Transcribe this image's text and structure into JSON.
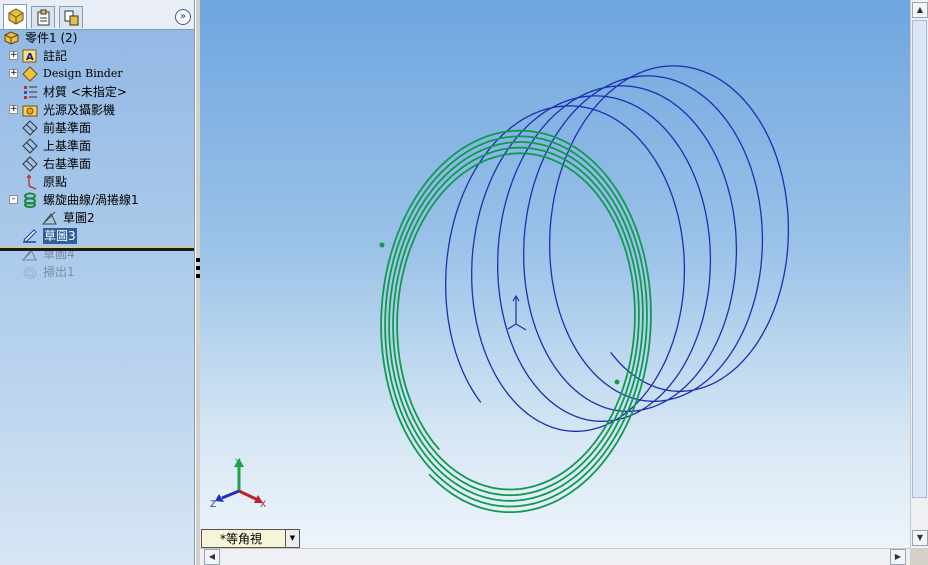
{
  "feature_manager": {
    "tabs": [
      {
        "icon": "feature-tree-icon",
        "active": true
      },
      {
        "icon": "property-manager-icon",
        "active": false
      },
      {
        "icon": "configuration-manager-icon",
        "active": false
      }
    ],
    "collapse_icon": "double-chevron-right-icon",
    "tree": [
      {
        "label": "零件1  (2)",
        "icon": "part-icon",
        "expander": "",
        "state": "normal"
      },
      {
        "label": "註記",
        "icon": "annotations-icon",
        "expander": "+",
        "state": "normal"
      },
      {
        "label": "Design Binder",
        "icon": "design-binder-icon",
        "expander": "+",
        "state": "normal"
      },
      {
        "label": "材質 <未指定>",
        "icon": "material-icon",
        "expander": "",
        "state": "normal"
      },
      {
        "label": "光源及攝影機",
        "icon": "lights-cameras-icon",
        "expander": "+",
        "state": "normal"
      },
      {
        "label": "前基準面",
        "icon": "plane-icon",
        "expander": "",
        "state": "normal"
      },
      {
        "label": "上基準面",
        "icon": "plane-icon",
        "expander": "",
        "state": "normal"
      },
      {
        "label": "右基準面",
        "icon": "plane-icon",
        "expander": "",
        "state": "normal"
      },
      {
        "label": "原點",
        "icon": "origin-icon",
        "expander": "",
        "state": "normal"
      },
      {
        "label": "螺旋曲線/渦捲線1",
        "icon": "helix-icon",
        "expander": "-",
        "state": "normal"
      },
      {
        "label": "草圖2",
        "icon": "sketch-icon",
        "expander": "",
        "state": "child"
      },
      {
        "label": "草圖3",
        "icon": "sketch-edit-icon",
        "expander": "",
        "state": "selected"
      },
      {
        "label": "草圖4",
        "icon": "sketch-icon",
        "expander": "",
        "state": "suppressed"
      },
      {
        "label": "掃出1",
        "icon": "sweep-icon",
        "expander": "",
        "state": "suppressed"
      }
    ]
  },
  "viewport": {
    "triad": {
      "x_label": "X",
      "y_label": "Y",
      "z_label": "Z"
    },
    "view_orientation": "*等角視",
    "curve_colors": {
      "helix": "#1c2fb0",
      "spiral": "#0f9a50",
      "triad_x": "#c0202a",
      "triad_y": "#20a040",
      "triad_z": "#2030c0"
    }
  },
  "scrollbars": {
    "up_icon": "arrow-up-icon",
    "down_icon": "arrow-down-icon",
    "left_icon": "arrow-left-icon",
    "right_icon": "arrow-right-icon"
  }
}
